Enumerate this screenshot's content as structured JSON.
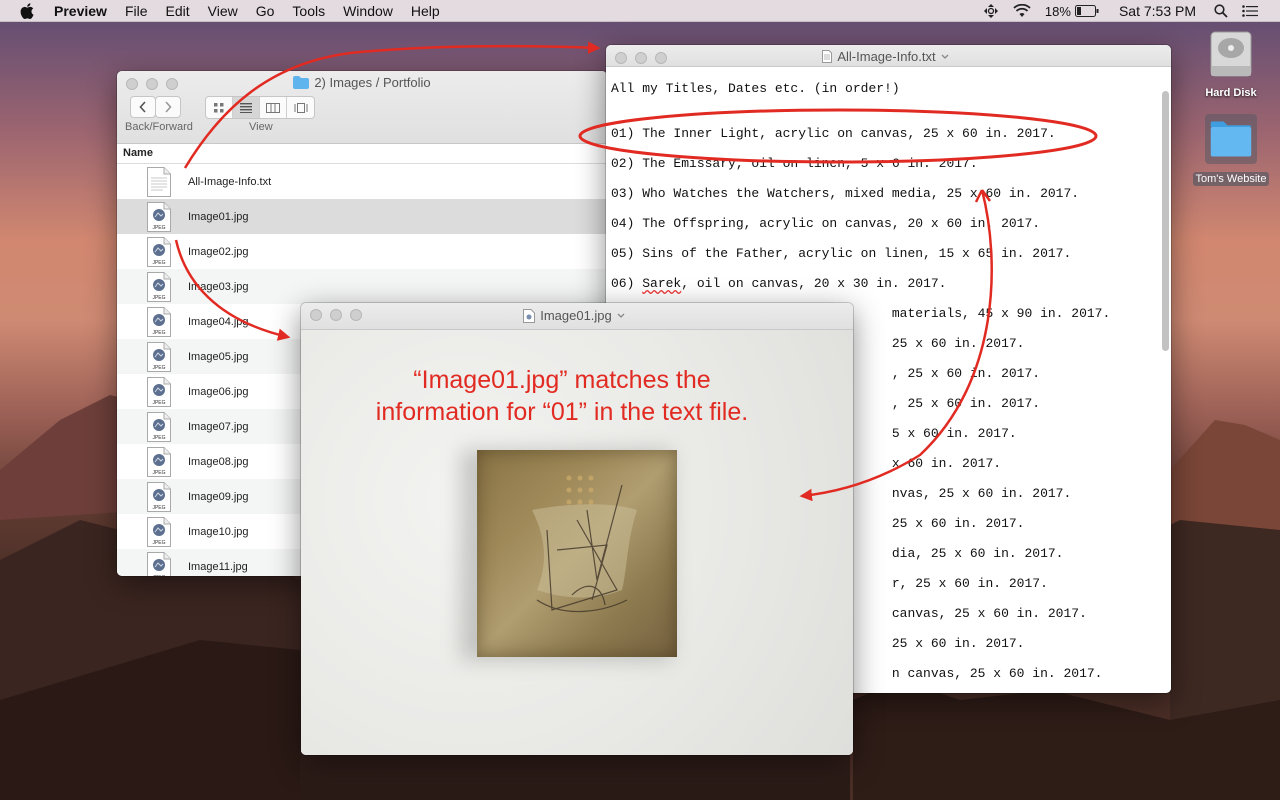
{
  "menubar": {
    "app_name": "Preview",
    "menus": [
      "File",
      "Edit",
      "View",
      "Go",
      "Tools",
      "Window",
      "Help"
    ],
    "battery": "18%",
    "clock": "Sat 7:53 PM"
  },
  "desktop": {
    "icons": [
      {
        "label": "Hard Disk",
        "icon": "hard-disk-icon"
      },
      {
        "label": "Tom's Website",
        "icon": "folder-icon"
      }
    ]
  },
  "finder": {
    "title": "2) Images / Portfolio",
    "back_forward_label": "Back/Forward",
    "view_label": "View",
    "column_header": "Name",
    "files": [
      {
        "name": "All-Image-Info.txt",
        "type": "txt",
        "selected": false
      },
      {
        "name": "Image01.jpg",
        "type": "jpeg",
        "selected": true
      },
      {
        "name": "Image02.jpg",
        "type": "jpeg",
        "selected": false
      },
      {
        "name": "Image03.jpg",
        "type": "jpeg",
        "selected": false
      },
      {
        "name": "Image04.jpg",
        "type": "jpeg",
        "selected": false
      },
      {
        "name": "Image05.jpg",
        "type": "jpeg",
        "selected": false
      },
      {
        "name": "Image06.jpg",
        "type": "jpeg",
        "selected": false
      },
      {
        "name": "Image07.jpg",
        "type": "jpeg",
        "selected": false
      },
      {
        "name": "Image08.jpg",
        "type": "jpeg",
        "selected": false
      },
      {
        "name": "Image09.jpg",
        "type": "jpeg",
        "selected": false
      },
      {
        "name": "Image10.jpg",
        "type": "jpeg",
        "selected": false
      },
      {
        "name": "Image11.jpg",
        "type": "jpeg",
        "selected": false
      }
    ],
    "jpeg_badge": "JPEG"
  },
  "textwin": {
    "title": "All-Image-Info.txt",
    "lines": [
      "All my Titles, Dates etc. (in order!)",
      "01) The Inner Light, acrylic on canvas, 25 x 60 in. 2017.",
      "02) The Emissary, oil on linen, 5 x 6 in. 2017.",
      "03) Who Watches the Watchers, mixed media, 25 x 60 in. 2017.",
      "04) The Offspring, acrylic on canvas, 20 x 60 in. 2017.",
      "05) Sins of the Father, acrylic on linen, 15 x 65 in. 2017.",
      "06) Sarek, oil on canvas, 20 x 30 in. 2017.",
      "                                    materials, 45 x 90 in. 2017.",
      "                                    25 x 60 in. 2017.",
      "                                    , 25 x 60 in. 2017.",
      "                                    , 25 x 60 in. 2017.",
      "                                    5 x 60 in. 2017.",
      "                                    x 60 in. 2017.",
      "                                    nvas, 25 x 60 in. 2017.",
      "                                    25 x 60 in. 2017.",
      "                                    dia, 25 x 60 in. 2017.",
      "                                    r, 25 x 60 in. 2017.",
      "                                    canvas, 25 x 60 in. 2017.",
      "                                    25 x 60 in. 2017.",
      "                                    n canvas, 25 x 60 in. 2017."
    ]
  },
  "imgwin": {
    "title": "Image01.jpg",
    "annotation_line1": "“Image01.jpg” matches the",
    "annotation_line2": "information for “01” in the text file."
  },
  "colors": {
    "annotation_red": "#e12b22",
    "folder_blue": "#5fb4ee"
  }
}
